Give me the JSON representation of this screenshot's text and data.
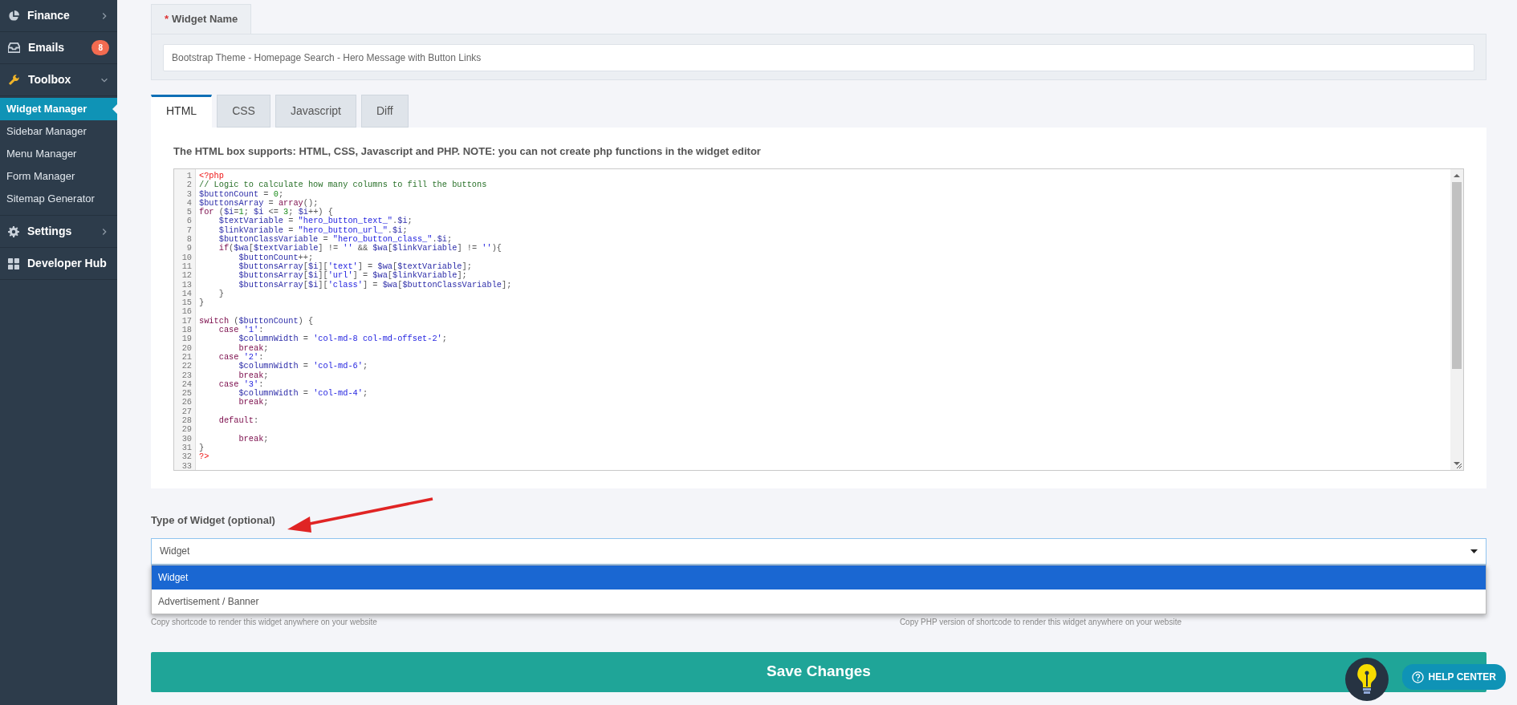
{
  "sidebar": {
    "items": [
      {
        "label": "Finance",
        "expanded": false
      },
      {
        "label": "Emails",
        "badge": "8"
      },
      {
        "label": "Toolbox",
        "expanded": true,
        "children": [
          {
            "label": "Widget Manager",
            "selected": true
          },
          {
            "label": "Sidebar Manager",
            "selected": false
          },
          {
            "label": "Menu Manager",
            "selected": false
          },
          {
            "label": "Form Manager",
            "selected": false
          },
          {
            "label": "Sitemap Generator",
            "selected": false
          }
        ]
      },
      {
        "label": "Settings",
        "expanded": false
      },
      {
        "label": "Developer Hub"
      }
    ]
  },
  "widget_name": {
    "required_mark": "*",
    "label": "Widget Name",
    "value": "Bootstrap Theme - Homepage Search - Hero Message with Button Links"
  },
  "editor_tabs": [
    {
      "label": "HTML",
      "selected": true
    },
    {
      "label": "CSS",
      "selected": false
    },
    {
      "label": "Javascript",
      "selected": false
    },
    {
      "label": "Diff",
      "selected": false
    }
  ],
  "editor": {
    "help": "The HTML box supports: HTML, CSS, Javascript and PHP. NOTE: you can not create php functions in the widget editor",
    "lines": [
      {
        "number": "1",
        "code": "<?php"
      },
      {
        "number": "2",
        "code": "// Logic to calculate how many columns to fill the buttons"
      },
      {
        "number": "3",
        "code": "$buttonCount = 0;"
      },
      {
        "number": "4",
        "code": "$buttonsArray = array();"
      },
      {
        "number": "5",
        "code": "for ($i=1; $i <= 3; $i++) {"
      },
      {
        "number": "6",
        "code": "    $textVariable = \"hero_button_text_\".$i;"
      },
      {
        "number": "7",
        "code": "    $linkVariable = \"hero_button_url_\".$i;"
      },
      {
        "number": "8",
        "code": "    $buttonClassVariable = \"hero_button_class_\".$i;"
      },
      {
        "number": "9",
        "code": "    if($wa[$textVariable] != '' && $wa[$linkVariable] != ''){"
      },
      {
        "number": "10",
        "code": "        $buttonCount++;"
      },
      {
        "number": "11",
        "code": "        $buttonsArray[$i]['text'] = $wa[$textVariable];"
      },
      {
        "number": "12",
        "code": "        $buttonsArray[$i]['url'] = $wa[$linkVariable];"
      },
      {
        "number": "13",
        "code": "        $buttonsArray[$i]['class'] = $wa[$buttonClassVariable];"
      },
      {
        "number": "14",
        "code": "    }"
      },
      {
        "number": "15",
        "code": "}"
      },
      {
        "number": "16"
      },
      {
        "number": "17",
        "code": "switch ($buttonCount) {"
      },
      {
        "number": "18",
        "code": "    case '1':"
      },
      {
        "number": "19",
        "code": "        $columnWidth = 'col-md-8 col-md-offset-2';"
      },
      {
        "number": "20",
        "code": "        break;"
      },
      {
        "number": "21",
        "code": "    case '2':"
      },
      {
        "number": "22",
        "code": "        $columnWidth = 'col-md-6';"
      },
      {
        "number": "23",
        "code": "        break;"
      },
      {
        "number": "24",
        "code": "    case '3':"
      },
      {
        "number": "25",
        "code": "        $columnWidth = 'col-md-4';"
      },
      {
        "number": "26",
        "code": "        break;"
      },
      {
        "number": "27"
      },
      {
        "number": "28",
        "code": "    default:"
      },
      {
        "number": "29"
      },
      {
        "number": "30",
        "code": "        break;"
      },
      {
        "number": "31",
        "code": "}"
      },
      {
        "number": "32",
        "code": "?>"
      },
      {
        "number": "33"
      }
    ]
  },
  "widget_type": {
    "label": "Type of Widget (optional)",
    "value": "Widget",
    "open": true,
    "options": [
      {
        "label": "Widget",
        "selected": true
      },
      {
        "label": "Advertisement / Banner",
        "selected": false
      }
    ]
  },
  "shortcode_hints": [
    "Copy shortcode to render this widget anywhere on your website",
    "Copy PHP version of shortcode to render this widget anywhere on your website"
  ],
  "save_button": "Save Changes",
  "help_center": "HELP CENTER"
}
